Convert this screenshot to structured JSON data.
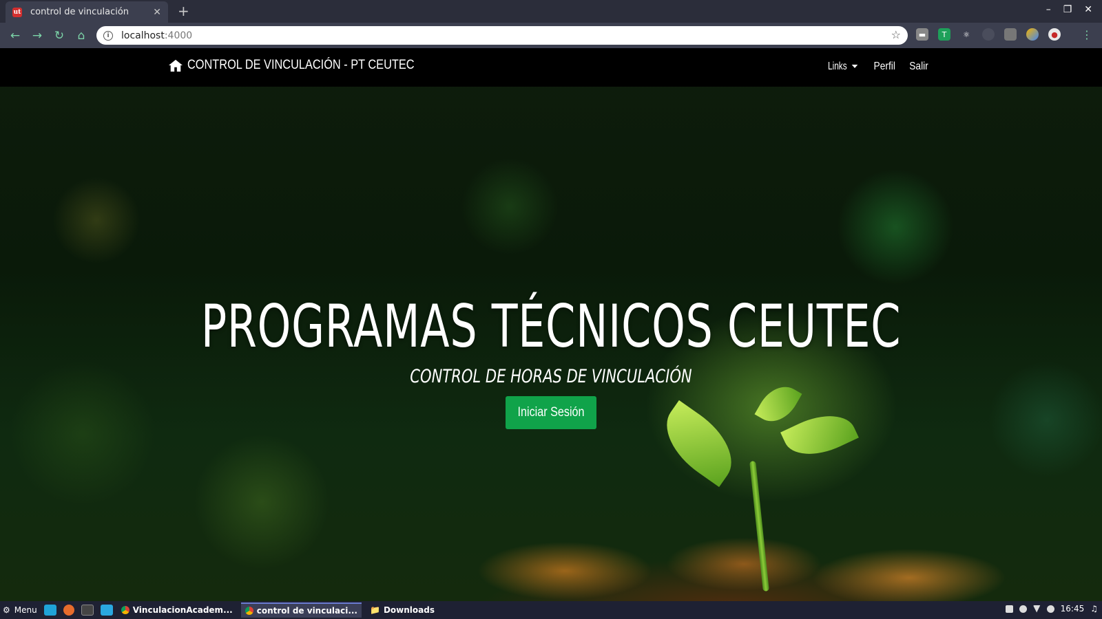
{
  "browser": {
    "tab_title": "control de vinculación",
    "tab_favicon": "ut",
    "url_host": "localhost",
    "url_port": ":4000"
  },
  "navbar": {
    "brand": "CONTROL DE VINCULACIÓN - PT CEUTEC",
    "links": [
      "Links",
      "Perfil",
      "Salir"
    ]
  },
  "hero": {
    "title": "PROGRAMAS TÉCNICOS CEUTEC",
    "subtitle": "CONTROL DE HORAS DE VINCULACIÓN",
    "button": "Iniciar Sesión"
  },
  "taskbar": {
    "menu_label": "Menu",
    "tasks": [
      "VinculacionAcadem...",
      "control de vinculaci...",
      "Downloads"
    ],
    "clock": "16:45"
  },
  "colors": {
    "accent_green": "#10a34a",
    "browser_icon_green": "#7cd4a8",
    "navbar_bg": "#000000"
  }
}
